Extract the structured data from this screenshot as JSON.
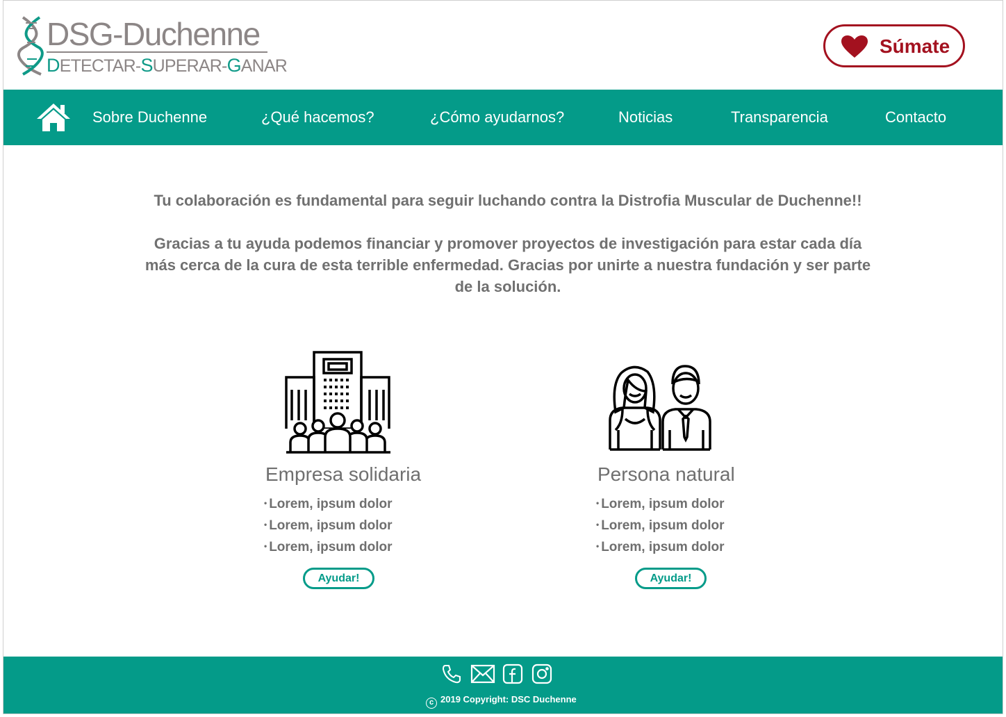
{
  "header": {
    "logo_title": "DSG-Duchenne",
    "logo_tagline_parts": [
      "D",
      "ETECTAR-",
      "S",
      "UPERAR-",
      "G",
      "ANAR"
    ],
    "sumate_label": "Súmate"
  },
  "nav": {
    "home_icon": "home-icon",
    "items": [
      "Sobre Duchenne",
      "¿Qué hacemos?",
      "¿Cómo ayudarnos?",
      "Noticias",
      "Transparencia",
      "Contacto"
    ]
  },
  "intro": {
    "line1": "Tu colaboración es fundamental para seguir luchando contra la Distrofia Muscular de Duchenne!!",
    "line2": "Gracias a tu ayuda podemos financiar y promover proyectos de investigación para estar cada día más cerca de la cura de esta terrible enfermedad. Gracias por unirte a nuestra fundación y ser parte de la solución."
  },
  "cards": [
    {
      "icon": "company-building-icon",
      "title": "Empresa solidaria",
      "items": [
        "Lorem, ipsum dolor",
        "Lorem, ipsum dolor",
        "Lorem, ipsum dolor"
      ],
      "button": "Ayudar!"
    },
    {
      "icon": "person-couple-icon",
      "title": "Persona natural",
      "items": [
        "Lorem, ipsum dolor",
        "Lorem, ipsum dolor",
        "Lorem, ipsum dolor"
      ],
      "button": "Ayudar!"
    }
  ],
  "footer": {
    "icons": [
      "phone-icon",
      "mail-icon",
      "facebook-icon",
      "instagram-icon"
    ],
    "copyright_symbol": "c",
    "copyright": "2019 Copyright: DSC Duchenne"
  },
  "colors": {
    "teal": "#049b89",
    "brand_red": "#a3111f",
    "logo_gray": "#8c8686",
    "text_gray": "#707070"
  }
}
